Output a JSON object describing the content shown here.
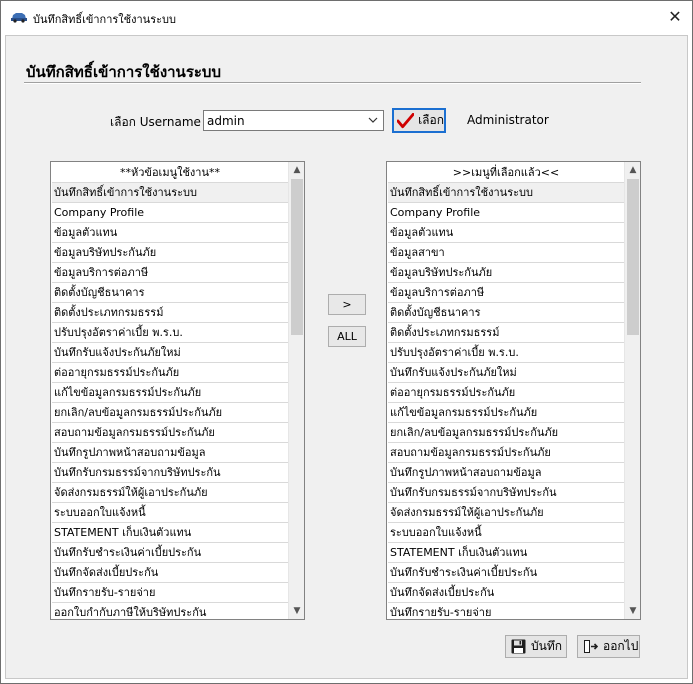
{
  "window": {
    "title": "บันทึกสิทธิ์เข้าการใช้งานระบบ",
    "close_glyph": "✕"
  },
  "form": {
    "heading": "บันทึกสิทธิ์เข้าการใช้งานระบบ",
    "username_label": "เลือก Username",
    "username_value": "admin",
    "select_button": "เลือก",
    "role_text": "Administrator"
  },
  "left_list": {
    "header": "**หัวข้อเมนูใช้งาน**",
    "items": [
      "บันทึกสิทธิ์เข้าการใช้งานระบบ",
      "Company Profile",
      "ข้อมูลตัวแทน",
      "ข้อมูลบริษัทประกันภัย",
      "ข้อมูลบริการต่อภาษี",
      "ติดตั้งบัญชีธนาคาร",
      "ติดตั้งประเภทกรมธรรม์",
      "ปรับปรุงอัตราค่าเบี้ย พ.ร.บ.",
      "บันทึกรับแจ้งประกันภัยใหม่",
      "ต่ออายุกรมธรรม์ประกันภัย",
      "แก้ไขข้อมูลกรมธรรม์ประกันภัย",
      "ยกเลิก/ลบข้อมูลกรมธรรม์ประกันภัย",
      "สอบถามข้อมูลกรมธรรม์ประกันภัย",
      "บันทึกรูปภาพหน้าสอบถามข้อมูล",
      "บันทึกรับกรมธรรม์จากบริษัทประกัน",
      "จัดส่งกรมธรรม์ให้ผู้เอาประกันภัย",
      "ระบบออกใบแจ้งหนี้",
      "STATEMENT เก็บเงินตัวแทน",
      "บันทึกรับชำระเงินค่าเบี้ยประกัน",
      "บันทึกจัดส่งเบี้ยประกัน",
      "บันทึกรายรับ-รายจ่าย",
      "ออกใบกำกับภาษีให้บริษัทประกัน"
    ]
  },
  "right_list": {
    "header": ">>เมนูที่เลือกแล้ว<<",
    "items": [
      "บันทึกสิทธิ์เข้าการใช้งานระบบ",
      "Company Profile",
      "ข้อมูลตัวแทน",
      "ข้อมูลสาขา",
      "ข้อมูลบริษัทประกันภัย",
      "ข้อมูลบริการต่อภาษี",
      "ติดตั้งบัญชีธนาคาร",
      "ติดตั้งประเภทกรมธรรม์",
      "ปรับปรุงอัตราค่าเบี้ย พ.ร.บ.",
      "บันทึกรับแจ้งประกันภัยใหม่",
      "ต่ออายุกรมธรรม์ประกันภัย",
      "แก้ไขข้อมูลกรมธรรม์ประกันภัย",
      "ยกเลิก/ลบข้อมูลกรมธรรม์ประกันภัย",
      "สอบถามข้อมูลกรมธรรม์ประกันภัย",
      "บันทึกรูปภาพหน้าสอบถามข้อมูล",
      "บันทึกรับกรมธรรม์จากบริษัทประกัน",
      "จัดส่งกรมธรรม์ให้ผู้เอาประกันภัย",
      "ระบบออกใบแจ้งหนี้",
      "STATEMENT เก็บเงินตัวแทน",
      "บันทึกรับชำระเงินค่าเบี้ยประกัน",
      "บันทึกจัดส่งเบี้ยประกัน",
      "บันทึกรายรับ-รายจ่าย"
    ]
  },
  "transfer": {
    "add_label": ">",
    "all_label": "ALL"
  },
  "footer": {
    "save_label": "บันทึก",
    "exit_label": "ออกไป"
  },
  "colors": {
    "accent": "#1b6fd1",
    "check": "#d00000"
  },
  "icons": {
    "app": "car-icon",
    "select": "check-icon",
    "save": "floppy-disk-icon",
    "exit": "exit-door-icon"
  }
}
